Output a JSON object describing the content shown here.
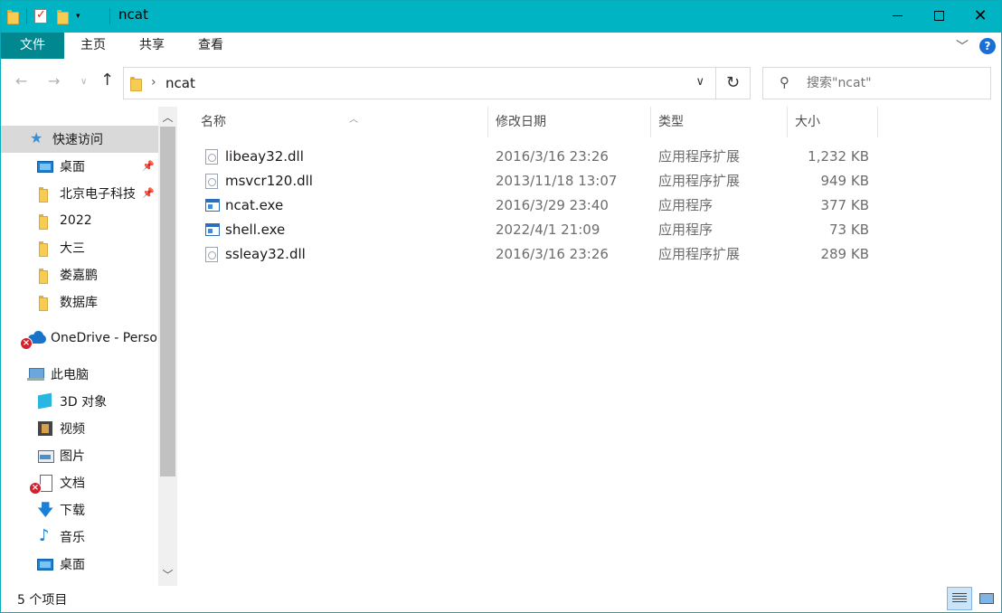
{
  "window": {
    "title": "ncat"
  },
  "ribbon": {
    "tabs": [
      "文件",
      "主页",
      "共享",
      "查看"
    ]
  },
  "address": {
    "crumb": "ncat",
    "refresh_icon": "refresh-icon"
  },
  "search": {
    "placeholder": "搜索\"ncat\""
  },
  "nav": {
    "items": [
      {
        "label": "快速访问",
        "icon": "star-icon",
        "selected": true
      },
      {
        "label": "桌面",
        "icon": "desktop-icon",
        "pinned": true
      },
      {
        "label": "北京电子科技",
        "icon": "folder-icon",
        "pinned": true
      },
      {
        "label": "2022",
        "icon": "folder-icon"
      },
      {
        "label": "大三",
        "icon": "folder-icon"
      },
      {
        "label": "娄嘉鹏",
        "icon": "folder-icon"
      },
      {
        "label": "数据库",
        "icon": "folder-icon"
      },
      {
        "label": "OneDrive - Personal",
        "icon": "onedrive-icon",
        "error": true
      },
      {
        "label": "此电脑",
        "icon": "pc-icon"
      },
      {
        "label": "3D 对象",
        "icon": "3d-objects-icon"
      },
      {
        "label": "视频",
        "icon": "video-icon"
      },
      {
        "label": "图片",
        "icon": "pictures-icon"
      },
      {
        "label": "文档",
        "icon": "documents-icon",
        "error": true
      },
      {
        "label": "下载",
        "icon": "download-icon"
      },
      {
        "label": "音乐",
        "icon": "music-icon"
      },
      {
        "label": "桌面",
        "icon": "desktop-icon"
      }
    ]
  },
  "files": {
    "columns": [
      "名称",
      "修改日期",
      "类型",
      "大小"
    ],
    "rows": [
      {
        "name": "libeay32.dll",
        "modified": "2016/3/16 23:26",
        "type": "应用程序扩展",
        "size": "1,232 KB",
        "kind": "dll"
      },
      {
        "name": "msvcr120.dll",
        "modified": "2013/11/18 13:07",
        "type": "应用程序扩展",
        "size": "949 KB",
        "kind": "dll"
      },
      {
        "name": "ncat.exe",
        "modified": "2016/3/29 23:40",
        "type": "应用程序",
        "size": "377 KB",
        "kind": "exe"
      },
      {
        "name": "shell.exe",
        "modified": "2022/4/1 21:09",
        "type": "应用程序",
        "size": "73 KB",
        "kind": "exe"
      },
      {
        "name": "ssleay32.dll",
        "modified": "2016/3/16 23:26",
        "type": "应用程序扩展",
        "size": "289 KB",
        "kind": "dll"
      }
    ]
  },
  "status": {
    "count": "5 个项目"
  },
  "colors": {
    "titlebar": "#00b4c4",
    "file_tab": "#00878f",
    "selection": "#d9d9d9"
  }
}
